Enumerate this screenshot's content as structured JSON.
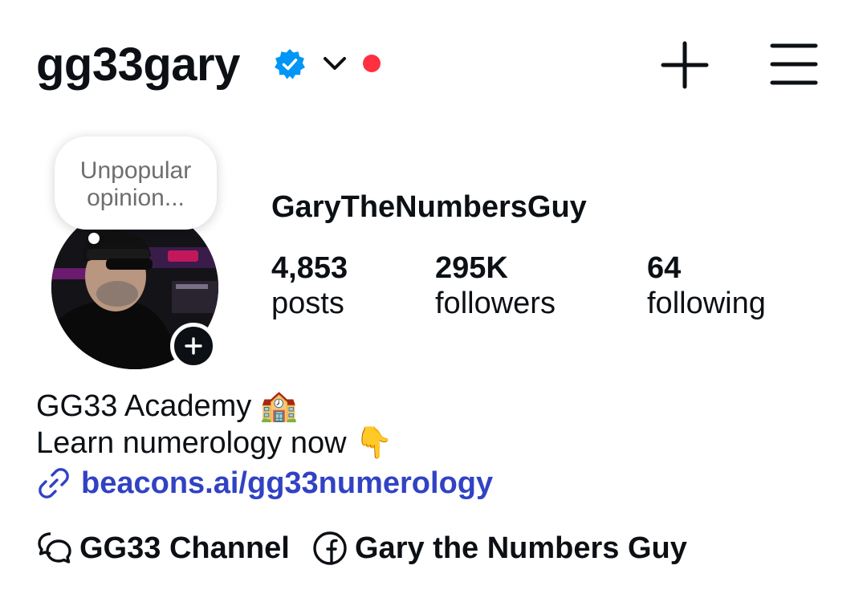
{
  "header": {
    "username": "gg33gary",
    "icons": {
      "verified": "verified-badge-icon",
      "chevron": "chevron-down-icon",
      "notification": "red-dot-indicator",
      "create": "plus-icon",
      "menu": "hamburger-menu-icon"
    }
  },
  "profile": {
    "note_text": "Unpopular opinion...",
    "display_name": "GaryTheNumbersGuy",
    "stats": [
      {
        "count": "4,853",
        "label": "posts"
      },
      {
        "count": "295K",
        "label": "followers"
      },
      {
        "count": "64",
        "label": "following"
      }
    ]
  },
  "bio": {
    "line1": "GG33 Academy 🏫",
    "line2": "Learn numerology now 👇",
    "link": "beacons.ai/gg33numerology"
  },
  "links": {
    "channel": "GG33 Channel",
    "facebook": "Gary the Numbers Guy"
  },
  "colors": {
    "verified": "#0095f6",
    "notification_dot": "#ff3040",
    "link": "#3142c4",
    "text": "#0c1014"
  }
}
